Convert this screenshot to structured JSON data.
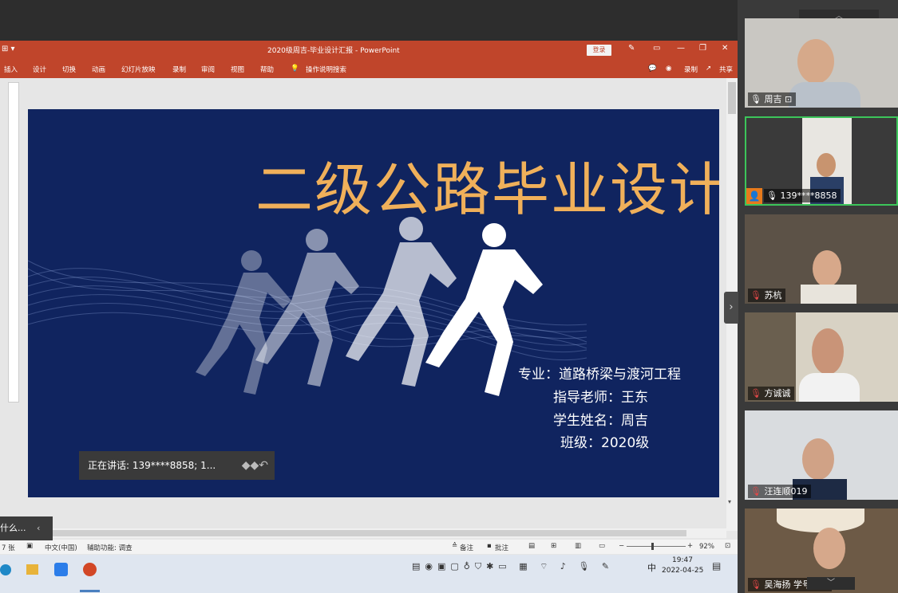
{
  "window": {
    "title": "2020级周吉-毕业设计汇报  -  PowerPoint",
    "login_label": "登录"
  },
  "ribbon": {
    "tabs": [
      "插入",
      "设计",
      "切换",
      "动画",
      "幻灯片放映",
      "录制",
      "审阅",
      "视图",
      "帮助"
    ],
    "search_label": "操作说明搜索",
    "record_label": "录制",
    "share_label": "共享"
  },
  "slide": {
    "title": "二级公路毕业设计",
    "major": "专业：道路桥梁与渡河工程",
    "advisor": "指导老师：王东",
    "student": "学生姓名：周吉",
    "class": "班级：2020级"
  },
  "meeting": {
    "speaking_text": "正在讲话: 139****8858; 1...",
    "popup_text": "什么..."
  },
  "statusbar": {
    "slide_count": "7 张",
    "language": "中文(中国)",
    "accessibility": "辅助功能: 调查",
    "notes_label": "备注",
    "comments_label": "批注",
    "zoom": "92%"
  },
  "taskbar": {
    "ime": "中",
    "time": "19:47",
    "date": "2022-04-25"
  },
  "participants": [
    {
      "name": "周吉",
      "muted": false,
      "bg": "#c9c7c2"
    },
    {
      "name": "139****8858",
      "muted": false,
      "bg": "#e8e6e1"
    },
    {
      "name": "苏杭",
      "muted": true,
      "bg": "#5c5247"
    },
    {
      "name": "方诚诚",
      "muted": true,
      "bg": "#d8d2c4"
    },
    {
      "name": "汪连顺019",
      "muted": true,
      "bg": "#d9dcdf"
    },
    {
      "name": "吴海扬 学号001",
      "muted": true,
      "bg": "#6d5a46"
    }
  ],
  "colors": {
    "ppt_red": "#c0452b",
    "slide_bg": "#10245f",
    "title_gold": "#f0b05a",
    "active_speaker": "#3cc55a"
  }
}
